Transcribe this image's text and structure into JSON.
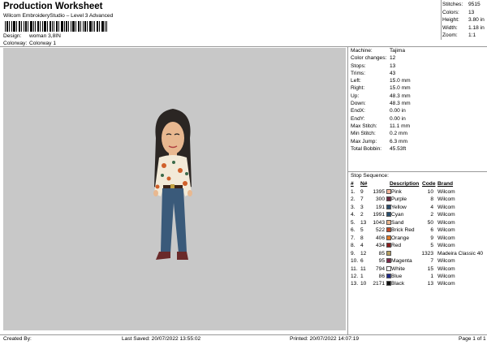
{
  "header": {
    "title": "Production Worksheet",
    "subtitle": "Wilcom EmbroideryStudio – Level 3 Advanced",
    "design_label": "Design:",
    "design_value": "woman 3,8IN",
    "colorway_label": "Colorway:",
    "colorway_value": "Colorway 1"
  },
  "summary": [
    {
      "label": "Stitches:",
      "value": "9515"
    },
    {
      "label": "Colors:",
      "value": "13"
    },
    {
      "label": "Height:",
      "value": "3.80 in"
    },
    {
      "label": "Width:",
      "value": "1.18 in"
    },
    {
      "label": "Zoom:",
      "value": "1:1"
    }
  ],
  "machine_info": [
    {
      "label": "Machine:",
      "value": "Tajima"
    },
    {
      "label": "Color changes:",
      "value": "12"
    },
    {
      "label": "Stops:",
      "value": "13"
    },
    {
      "label": "Trims:",
      "value": "43"
    },
    {
      "label": "Left:",
      "value": "15.0 mm"
    },
    {
      "label": "Right:",
      "value": "15.0 mm"
    },
    {
      "label": "Up:",
      "value": "48.3 mm"
    },
    {
      "label": "Down:",
      "value": "48.3 mm"
    },
    {
      "label": "EndX:",
      "value": "0.00 in"
    },
    {
      "label": "EndY:",
      "value": "0.00 in"
    },
    {
      "label": "Max Stitch:",
      "value": "11.1 mm"
    },
    {
      "label": "Min Stitch:",
      "value": "0.2 mm"
    },
    {
      "label": "Max Jump:",
      "value": "6.3 mm"
    },
    {
      "label": "Total Bobbin:",
      "value": "45.53ft"
    }
  ],
  "stop_sequence": {
    "title": "Stop Sequence:",
    "headers": {
      "num": "#",
      "n": "N#",
      "desc": "Description",
      "code": "Code",
      "brand": "Brand"
    },
    "rows": [
      {
        "num": "1.",
        "n": "9",
        "stitches": "1395",
        "color": "#f2b49a",
        "desc": "Pink",
        "code": "10",
        "brand": "Wilcom"
      },
      {
        "num": "2.",
        "n": "7",
        "stitches": "300",
        "color": "#6b2a3f",
        "desc": "Purple",
        "code": "8",
        "brand": "Wilcom"
      },
      {
        "num": "3.",
        "n": "3",
        "stitches": "191",
        "color": "#2e4e6e",
        "desc": "Yellow",
        "code": "4",
        "brand": "Wilcom"
      },
      {
        "num": "4.",
        "n": "2",
        "stitches": "1991",
        "color": "#2b4f6e",
        "desc": "Cyan",
        "code": "2",
        "brand": "Wilcom"
      },
      {
        "num": "5.",
        "n": "13",
        "stitches": "1043",
        "color": "#e8b48c",
        "desc": "Sand",
        "code": "50",
        "brand": "Wilcom"
      },
      {
        "num": "6.",
        "n": "5",
        "stitches": "522",
        "color": "#c04a2a",
        "desc": "Brick Red",
        "code": "6",
        "brand": "Wilcom"
      },
      {
        "num": "7.",
        "n": "8",
        "stitches": "406",
        "color": "#e07a2a",
        "desc": "Orange",
        "code": "9",
        "brand": "Wilcom"
      },
      {
        "num": "8.",
        "n": "4",
        "stitches": "434",
        "color": "#8a1e1e",
        "desc": "Red",
        "code": "5",
        "brand": "Wilcom"
      },
      {
        "num": "9.",
        "n": "12",
        "stitches": "85",
        "color": "#b8a060",
        "desc": "",
        "code": "1323",
        "brand": "Madeira Classic 40"
      },
      {
        "num": "10.",
        "n": "6",
        "stitches": "95",
        "color": "#7a2a4a",
        "desc": "Magenta",
        "code": "7",
        "brand": "Wilcom"
      },
      {
        "num": "11.",
        "n": "11",
        "stitches": "794",
        "color": "#ffffff",
        "desc": "White",
        "code": "15",
        "brand": "Wilcom"
      },
      {
        "num": "12.",
        "n": "1",
        "stitches": "86",
        "color": "#1e2a8a",
        "desc": "Blue",
        "code": "1",
        "brand": "Wilcom"
      },
      {
        "num": "13.",
        "n": "10",
        "stitches": "2171",
        "color": "#111111",
        "desc": "Black",
        "code": "13",
        "brand": "Wilcom"
      }
    ]
  },
  "footer": {
    "created_by": "Created By:",
    "last_saved": "Last Saved: 20/07/2022 13:55:02",
    "printed": "Printed: 20/07/2022 14:07:19",
    "page": "Page 1 of 1"
  }
}
